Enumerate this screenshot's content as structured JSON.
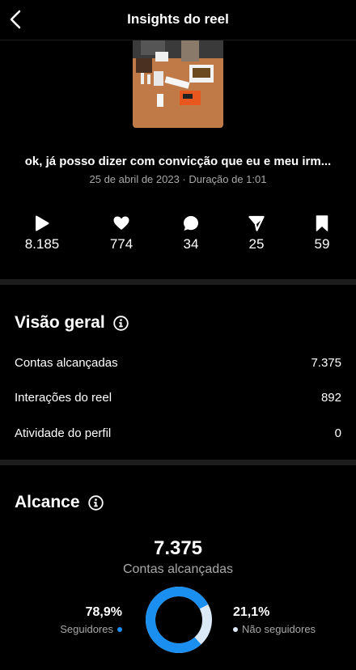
{
  "header": {
    "title": "Insights do reel"
  },
  "reel": {
    "caption": "ok, já posso dizer com convicção que eu e meu irm...",
    "meta": "25 de abril de 2023 · Duração de 1:01"
  },
  "stats": [
    {
      "icon": "play-icon",
      "value": "8.185"
    },
    {
      "icon": "heart-icon",
      "value": "774"
    },
    {
      "icon": "comment-icon",
      "value": "34"
    },
    {
      "icon": "share-icon",
      "value": "25"
    },
    {
      "icon": "bookmark-icon",
      "value": "59"
    }
  ],
  "overview": {
    "title": "Visão geral",
    "rows": [
      {
        "label": "Contas alcançadas",
        "value": "7.375"
      },
      {
        "label": "Interações do reel",
        "value": "892"
      },
      {
        "label": "Atividade do perfil",
        "value": "0"
      }
    ]
  },
  "reach": {
    "title": "Alcance",
    "total": "7.375",
    "total_label": "Contas alcançadas",
    "followers_pct": "78,9%",
    "followers_label": "Seguidores",
    "non_followers_pct": "21,1%",
    "non_followers_label": "Não seguidores",
    "followers_fraction": 0.789,
    "colors": {
      "followers": "#1a8ff0",
      "non_followers": "#dbe9f6"
    }
  }
}
